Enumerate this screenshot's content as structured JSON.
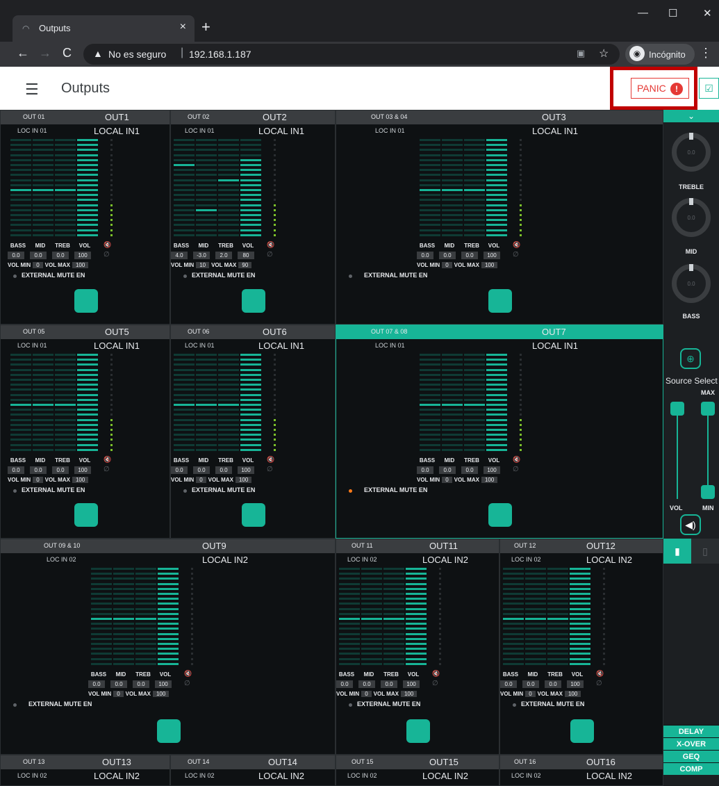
{
  "browser": {
    "tab_title": "Outputs",
    "tab_close": "×",
    "new_tab": "+",
    "win_min": "—",
    "win_max": "☐",
    "win_close": "✕",
    "not_secure": "No es seguro",
    "url": "192.168.1.187",
    "incognito_label": "Incógnito"
  },
  "app": {
    "title": "Outputs",
    "panic_label": "PANIC",
    "panic_icon": "!"
  },
  "outputs": [
    {
      "id": "OUT 01",
      "name": "OUT1",
      "src_id": "LOC IN 01",
      "src_name": "LOCAL IN1",
      "bass": "0.0",
      "mid": "0.0",
      "treb": "0.0",
      "vol": "100",
      "vol_min": "0",
      "vol_max": "100",
      "ext_mute": "EXTERNAL MUTE EN"
    },
    {
      "id": "OUT 02",
      "name": "OUT2",
      "src_id": "LOC IN 01",
      "src_name": "LOCAL IN1",
      "bass": "4.0",
      "mid": "-3.0",
      "treb": "2.0",
      "vol": "80",
      "vol_min": "10",
      "vol_max": "90",
      "ext_mute": "EXTERNAL MUTE EN"
    },
    {
      "id": "OUT 03 & 04",
      "name": "OUT3",
      "src_id": "LOC IN 01",
      "src_name": "LOCAL IN1",
      "bass": "0.0",
      "mid": "0.0",
      "treb": "0.0",
      "vol": "100",
      "vol_min": "0",
      "vol_max": "100",
      "ext_mute": "EXTERNAL MUTE EN"
    },
    {
      "id": "OUT 05",
      "name": "OUT5",
      "src_id": "LOC IN 01",
      "src_name": "LOCAL IN1",
      "bass": "0.0",
      "mid": "0.0",
      "treb": "0.0",
      "vol": "100",
      "vol_min": "0",
      "vol_max": "100",
      "ext_mute": "EXTERNAL MUTE EN"
    },
    {
      "id": "OUT 06",
      "name": "OUT6",
      "src_id": "LOC IN 01",
      "src_name": "LOCAL IN1",
      "bass": "0.0",
      "mid": "0.0",
      "treb": "0.0",
      "vol": "100",
      "vol_min": "0",
      "vol_max": "100",
      "ext_mute": "EXTERNAL MUTE EN"
    },
    {
      "id": "OUT 07 & 08",
      "name": "OUT7",
      "src_id": "LOC IN 01",
      "src_name": "LOCAL IN1",
      "bass": "0.0",
      "mid": "0.0",
      "treb": "0.0",
      "vol": "100",
      "vol_min": "0",
      "vol_max": "100",
      "ext_mute": "EXTERNAL MUTE EN"
    },
    {
      "id": "OUT 09 & 10",
      "name": "OUT9",
      "src_id": "LOC IN 02",
      "src_name": "LOCAL IN2",
      "bass": "0.0",
      "mid": "0.0",
      "treb": "0.0",
      "vol": "100",
      "vol_min": "0",
      "vol_max": "100",
      "ext_mute": "EXTERNAL MUTE EN"
    },
    {
      "id": "OUT 11",
      "name": "OUT11",
      "src_id": "LOC IN 02",
      "src_name": "LOCAL IN2",
      "bass": "0.0",
      "mid": "0.0",
      "treb": "0.0",
      "vol": "100",
      "vol_min": "0",
      "vol_max": "100",
      "ext_mute": "EXTERNAL MUTE EN"
    },
    {
      "id": "OUT 12",
      "name": "OUT12",
      "src_id": "LOC IN 02",
      "src_name": "LOCAL IN2",
      "bass": "0.0",
      "mid": "0.0",
      "treb": "0.0",
      "vol": "100",
      "vol_min": "0",
      "vol_max": "100",
      "ext_mute": "EXTERNAL MUTE EN"
    },
    {
      "id": "OUT 13",
      "name": "OUT13",
      "src_id": "LOC IN 02",
      "src_name": "LOCAL IN2"
    },
    {
      "id": "OUT 14",
      "name": "OUT14",
      "src_id": "LOC IN 02",
      "src_name": "LOCAL IN2"
    },
    {
      "id": "OUT 15",
      "name": "OUT15",
      "src_id": "LOC IN 02",
      "src_name": "LOCAL IN2"
    },
    {
      "id": "OUT 16",
      "name": "OUT16",
      "src_id": "LOC IN 02",
      "src_name": "LOCAL IN2"
    }
  ],
  "labels": {
    "bass": "BASS",
    "mid": "MID",
    "treb": "TREB",
    "vol": "VOL",
    "vol_min": "VOL MIN",
    "vol_max": "VOL MAX"
  },
  "panel": {
    "treble_label": "TREBLE",
    "mid_label": "MID",
    "bass_label": "BASS",
    "treble_value": "0.0",
    "mid_value": "0.0",
    "bass_value": "0.0",
    "source_select": "Source Select",
    "max_label": "MAX",
    "vol_label": "VOL",
    "min_label": "MIN",
    "buttons": [
      "DELAY",
      "X-OVER",
      "GEQ",
      "COMP"
    ]
  },
  "colors": {
    "accent": "#17b597",
    "panic": "#e53935",
    "highlight_box": "#c00000"
  }
}
